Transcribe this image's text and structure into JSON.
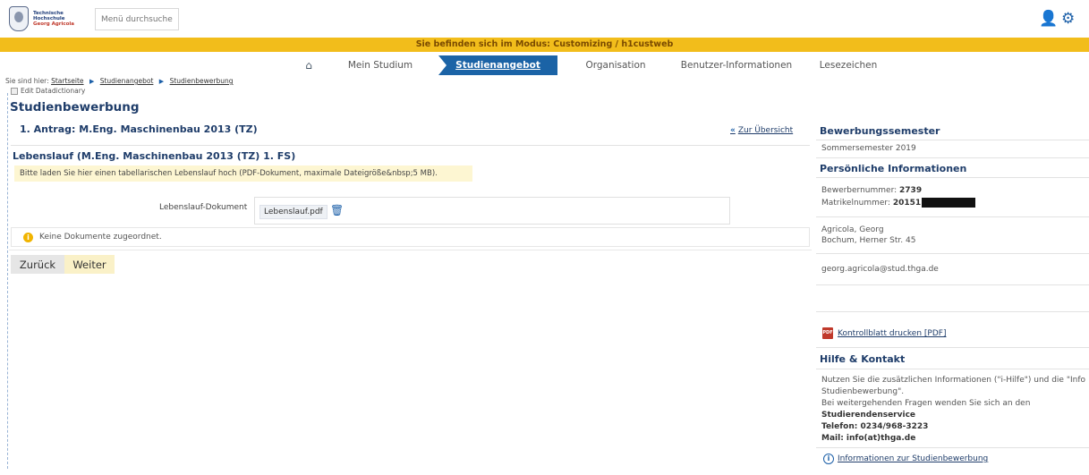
{
  "header": {
    "logo_line1": "Technische",
    "logo_line2": "Hochschule",
    "logo_line3": "Georg Agricola",
    "search_placeholder": "Menü durchsuchen"
  },
  "mode_banner": "Sie befinden sich im Modus: Customizing / h1custweb",
  "nav": [
    {
      "label": "Mein Studium"
    },
    {
      "label": "Studienangebot"
    },
    {
      "label": "Organisation"
    },
    {
      "label": "Benutzer-Informationen"
    },
    {
      "label": "Lesezeichen"
    }
  ],
  "breadcrumb": {
    "prefix": "Sie sind hier:",
    "items": [
      "Startseite",
      "Studienangebot",
      "Studienbewerbung"
    ]
  },
  "edit_datadictionary": "Edit Datadictionary",
  "page_title": "Studienbewerbung",
  "antrag_title": "1. Antrag: M.Eng. Maschinenbau 2013 (TZ)",
  "back_link": "Zur Übersicht",
  "section": {
    "title": "Lebenslauf (M.Eng. Maschinenbau 2013 (TZ) 1. FS)",
    "info": "Bitte laden Sie hier einen tabellarischen Lebenslauf hoch (PDF-Dokument, maximale Dateigröße&nbsp;5 MB).",
    "doc_label": "Lebenslauf-Dokument",
    "doc_file": "Lebenslauf.pdf",
    "notice": "Keine Dokumente zugeordnet."
  },
  "buttons": {
    "back": "Zurück",
    "next": "Weiter"
  },
  "sidebar": {
    "semester_head": "Bewerbungssemester",
    "semester_value": "Sommersemester 2019",
    "personal_head": "Persönliche Informationen",
    "applicant_label": "Bewerbernummer:",
    "applicant_value": "2739",
    "matrikel_label": "Matrikelnummer:",
    "matrikel_value": "20151",
    "name": "Agricola, Georg",
    "address": "Bochum, Herner Str. 45",
    "email": "georg.agricola@stud.thga.de",
    "print_link": "Kontrollblatt drucken [PDF]",
    "help_head": "Hilfe & Kontakt",
    "help_line1": "Nutzen Sie die zusätzlichen Informationen (\"i-Hilfe\") und die \"Info",
    "help_line2": "Studienbewerbung\".",
    "help_line3": "Bei weitergehenden Fragen wenden Sie sich an den",
    "help_service": "Studierendenservice",
    "help_phone": "Telefon: 0234/968-3223",
    "help_mail": "Mail: info(at)thga.de",
    "info_link": "Informationen zur Studienbewerbung"
  },
  "colors": {
    "accent": "#1b63a6",
    "banner": "#f2bd1b",
    "title": "#1f3d6a"
  }
}
